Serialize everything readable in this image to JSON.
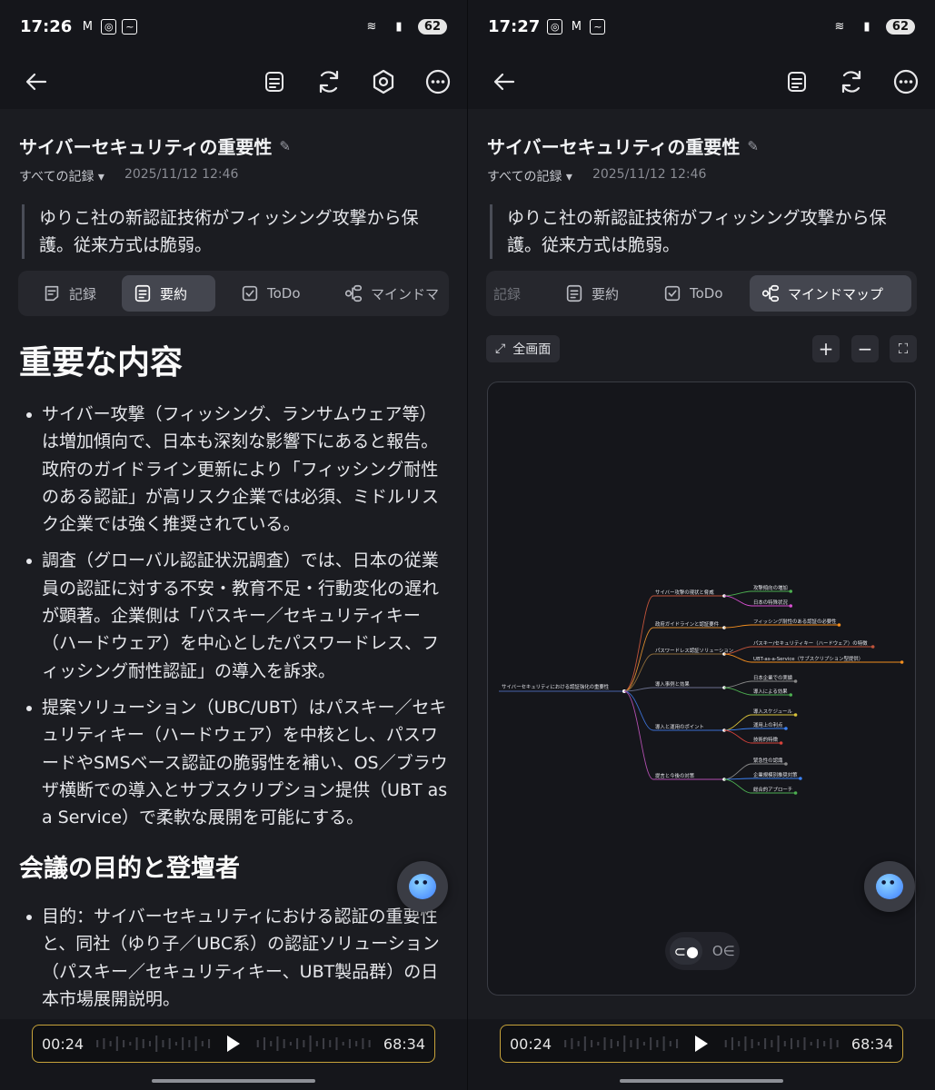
{
  "status": {
    "left_time": "17:26",
    "right_time": "17:27",
    "battery": "62"
  },
  "note": {
    "title": "サイバーセキュリティの重要性",
    "folder": "すべての記録",
    "date": "2025/11/12 12:46",
    "summary_quote": "ゆりこ社の新認証技術がフィッシング攻撃から保護。従来方式は脆弱。"
  },
  "tabs": [
    {
      "label": "記録",
      "icon": "record-icon"
    },
    {
      "label": "要約",
      "icon": "summary-icon"
    },
    {
      "label": "ToDo",
      "icon": "todo-icon"
    },
    {
      "label": "マインドマップ",
      "icon": "mindmap-icon"
    }
  ],
  "left_tab_partial": "マインドマ",
  "summary": {
    "section1_heading": "重要な内容",
    "section1_items": [
      "サイバー攻撃（フィッシング、ランサムウェア等）は増加傾向で、日本も深刻な影響下にあると報告。政府のガイドライン更新により「フィッシング耐性のある認証」が高リスク企業では必須、ミドルリスク企業では強く推奨されている。",
      "調査（グローバル認証状況調査）では、日本の従業員の認証に対する不安・教育不足・行動変化の遅れが顕著。企業側は「パスキー／セキュリティキー（ハードウェア）を中心としたパスワードレス、フィッシング耐性認証」の導入を訴求。",
      "提案ソリューション（UBC/UBT）はパスキー／セキュリティキー（ハードウェア）を中核とし、パスワードやSMSベース認証の脆弱性を補い、OS／ブラウザ横断での導入とサブスクリプション提供（UBT as a Service）で柔軟な展開を可能にする。"
    ],
    "section2_heading": "会議の目的と登壇者",
    "section2_items": [
      "目的：サイバーセキュリティにおける認証の重要性と、同社（ゆり子／UBC系）の認証ソリューション（パスキー／セキュリティキー、UBT製品群）の日本市場展開説明。"
    ]
  },
  "mindmap": {
    "fullscreen_label": "全画面",
    "zoom_in": "+",
    "zoom_out": "−",
    "root": "サイバーセキュリティにおける認証強化の重要性",
    "branches": [
      {
        "label": "サイバー攻撃の現状と脅威",
        "color": "#c0533a",
        "children": [
          {
            "label": "攻撃傾向の増加",
            "color": "#4caf50"
          },
          {
            "label": "日本の特殊状況",
            "color": "#d84fd1"
          }
        ]
      },
      {
        "label": "政府ガイドラインと認証要件",
        "color": "#d98a2f",
        "children": [
          {
            "label": "フィッシング耐性のある認証の必要性",
            "color": "#f28d1e"
          }
        ]
      },
      {
        "label": "パスワードレス認証ソリューション",
        "color": "#8b6a3a",
        "children": [
          {
            "label": "パスキー/セキュリティキー（ハードウェア）の特徴",
            "color": "#c0533a"
          },
          {
            "label": "UBT-as-a-Service（サブスクリプション型提供）",
            "color": "#f28d1e"
          }
        ]
      },
      {
        "label": "導入事例と効果",
        "color": "#6a6f8c",
        "children": [
          {
            "label": "日本企業での実績",
            "color": "#888888"
          },
          {
            "label": "導入による効果",
            "color": "#4caf50"
          }
        ]
      },
      {
        "label": "導入と運用のポイント",
        "color": "#3b6fd1",
        "children": [
          {
            "label": "導入スケジュール",
            "color": "#d8c13a"
          },
          {
            "label": "運用上の利点",
            "color": "#3b82f6"
          },
          {
            "label": "技術的特徴",
            "color": "#d8423a"
          }
        ]
      },
      {
        "label": "提言と今後の対策",
        "color": "#b24fb0",
        "children": [
          {
            "label": "緊急性の認識",
            "color": "#888888"
          },
          {
            "label": "企業規模別推奨対策",
            "color": "#3b82f6"
          },
          {
            "label": "総合的アプローチ",
            "color": "#4caf50"
          }
        ]
      }
    ]
  },
  "player": {
    "elapsed": "00:24",
    "total": "68:34"
  }
}
